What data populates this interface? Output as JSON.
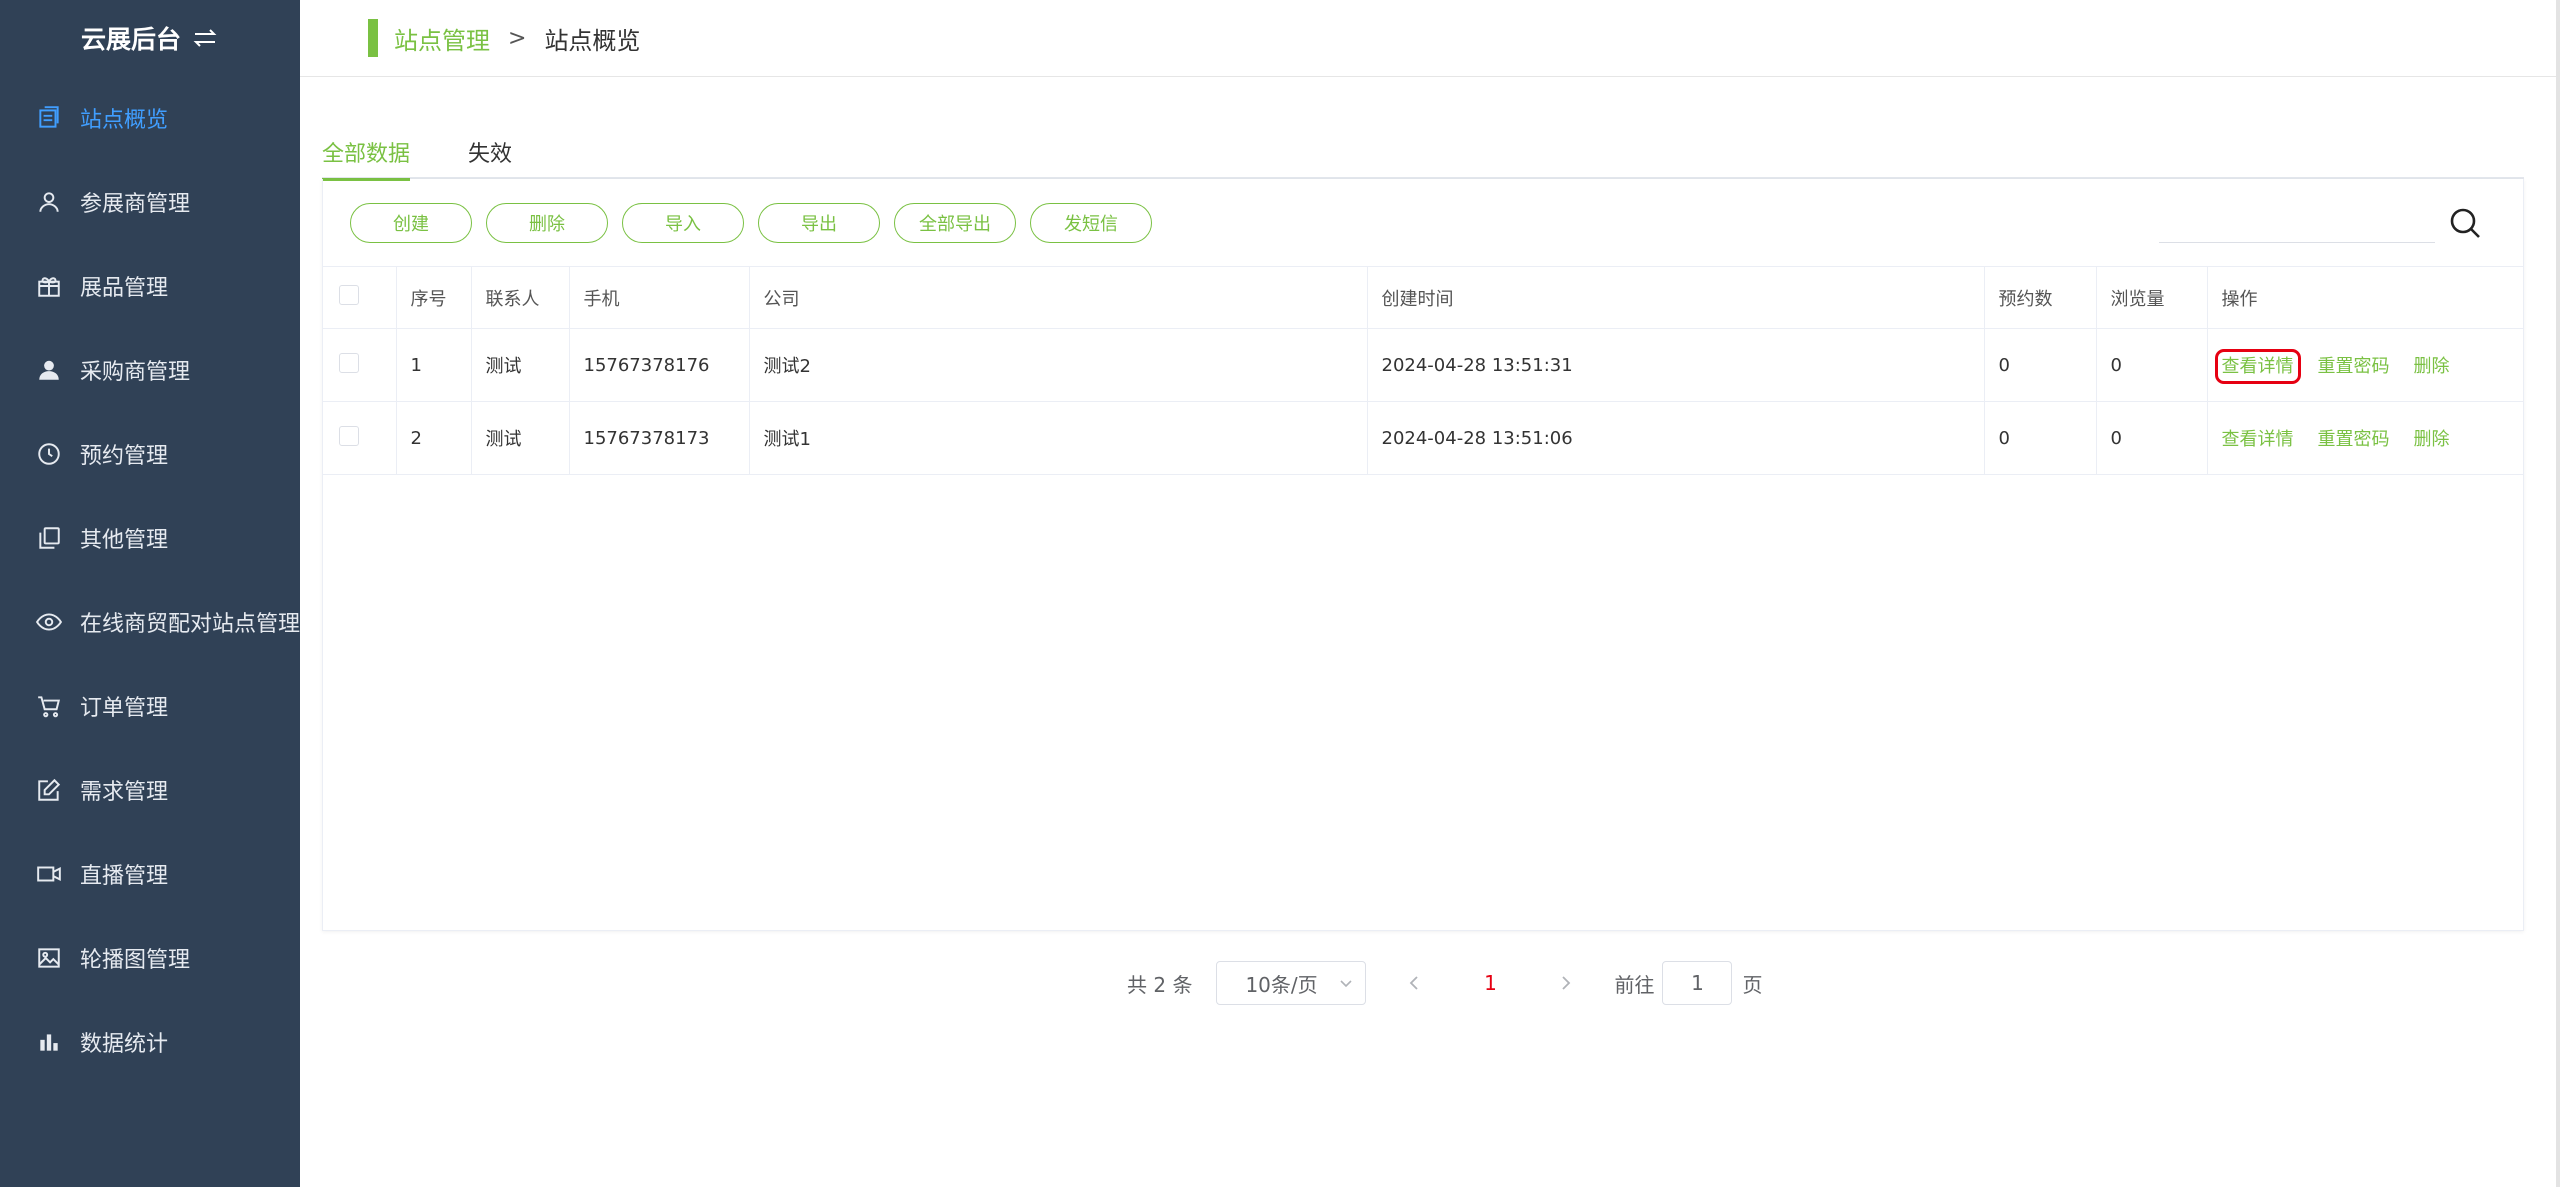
{
  "brand": {
    "title": "云展后台"
  },
  "sidebar": {
    "items": [
      {
        "label": "站点概览",
        "icon": "document-icon",
        "active": true
      },
      {
        "label": "参展商管理",
        "icon": "user-outline-icon"
      },
      {
        "label": "展品管理",
        "icon": "gift-icon"
      },
      {
        "label": "采购商管理",
        "icon": "user-solid-icon"
      },
      {
        "label": "预约管理",
        "icon": "clock-icon"
      },
      {
        "label": "其他管理",
        "icon": "copy-icon"
      },
      {
        "label": "在线商贸配对站点管理",
        "icon": "eye-icon"
      },
      {
        "label": "订单管理",
        "icon": "cart-icon"
      },
      {
        "label": "需求管理",
        "icon": "edit-icon"
      },
      {
        "label": "直播管理",
        "icon": "video-camera-icon"
      },
      {
        "label": "轮播图管理",
        "icon": "picture-icon"
      },
      {
        "label": "数据统计",
        "icon": "bar-chart-icon"
      }
    ]
  },
  "breadcrumb": {
    "parent": "站点管理",
    "separator": ">",
    "current": "站点概览"
  },
  "tabs": [
    {
      "label": "全部数据",
      "active": true
    },
    {
      "label": "失效"
    }
  ],
  "toolbar": {
    "create": "创建",
    "delete": "删除",
    "import": "导入",
    "export": "导出",
    "export_all": "全部导出",
    "send_sms": "发短信"
  },
  "search": {
    "placeholder": ""
  },
  "table": {
    "headers": {
      "index": "序号",
      "contact": "联系人",
      "phone": "手机",
      "company": "公司",
      "created": "创建时间",
      "bookings": "预约数",
      "views": "浏览量",
      "actions": "操作"
    },
    "rows": [
      {
        "index": "1",
        "contact": "测试",
        "phone": "15767378176",
        "company": "测试2",
        "created": "2024-04-28 13:51:31",
        "bookings": "0",
        "views": "0"
      },
      {
        "index": "2",
        "contact": "测试",
        "phone": "15767378173",
        "company": "测试1",
        "created": "2024-04-28 13:51:06",
        "bookings": "0",
        "views": "0"
      }
    ],
    "actions": {
      "view": "查看详情",
      "reset": "重置密码",
      "delete": "删除"
    }
  },
  "pagination": {
    "total": "共 2 条",
    "page_size": "10条/页",
    "current_page": "1",
    "goto_label": "前往",
    "goto_value": "1",
    "page_unit": "页"
  },
  "colors": {
    "sidebar_bg": "#304156",
    "accent_green": "#7ac143",
    "active_blue": "#409eff",
    "highlight_red": "#e60012"
  }
}
